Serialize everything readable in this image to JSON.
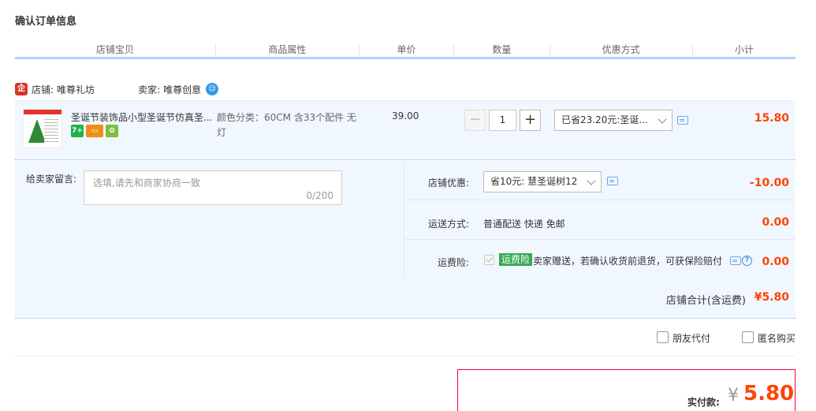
{
  "page": {
    "title": "确认订单信息"
  },
  "table_header": {
    "columns": [
      "店铺宝贝",
      "商品属性",
      "单价",
      "数量",
      "优惠方式",
      "小计"
    ]
  },
  "shop": {
    "shop_label": "店铺:",
    "shop_name": "唯尊礼坊",
    "seller_label": "卖家:",
    "seller_name": "唯尊创意",
    "seller_icon": "wangwang-icon"
  },
  "item": {
    "title": "圣诞节装饰品小型圣诞节仿真圣...",
    "badges": [
      "7+",
      "",
      ""
    ],
    "attribute": "颜色分类：60CM 含33个配件 无灯",
    "price": "39.00",
    "quantity": "1",
    "minus": "−",
    "plus": "+",
    "promotion": "已省23.20元:圣诞...",
    "subtotal": "15.80"
  },
  "memo": {
    "label": "给卖家留言:",
    "placeholder": "选填,请先和商家协商一致",
    "counter": "0/200"
  },
  "options": {
    "coupon_label": "店铺优惠:",
    "coupon_value": "省10元: 慧圣诞树12",
    "coupon_price": "-10.00",
    "shipping_label": "运送方式:",
    "shipping_value": "普通配送 快递 免邮",
    "shipping_price": "0.00",
    "insurance_label": "运费险:",
    "insurance_tag": "运费险",
    "insurance_text": "卖家赠送，若确认收货前退货，可获保险赔付",
    "insurance_price": "0.00"
  },
  "shop_total": {
    "label": "店铺合计(含运费)",
    "value": "¥5.80"
  },
  "extras": {
    "friend_pay": "朋友代付",
    "anonymous": "匿名购买"
  },
  "payment": {
    "label": "实付款:",
    "currency": "¥",
    "amount": "5.80"
  },
  "colors": {
    "accent_price": "#ff4400",
    "header_underline": "#b2d1ff",
    "row_bg": "#f1f7ff",
    "pay_border": "#ff0036"
  }
}
